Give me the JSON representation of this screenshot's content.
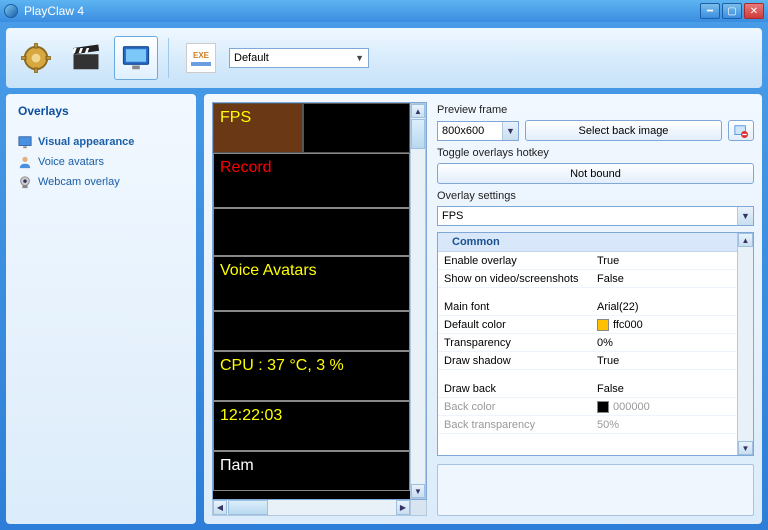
{
  "window": {
    "title": "PlayClaw 4"
  },
  "toolbar": {
    "profile_label": "Default",
    "icons": {
      "settings": "gear-icon",
      "recording": "clapper-icon",
      "overlays": "monitor-icon",
      "exe": "exe-icon"
    }
  },
  "sidebar": {
    "header": "Overlays",
    "items": [
      {
        "label": "Visual appearance",
        "selected": true
      },
      {
        "label": "Voice avatars",
        "selected": false
      },
      {
        "label": "Webcam overlay",
        "selected": false
      }
    ]
  },
  "preview": {
    "overlays": {
      "fps": "FPS",
      "record": "Record",
      "voice": "Voice Avatars",
      "cpu": "CPU : 37 °C, 3 %",
      "time": "12:22:03",
      "cam": "Пam"
    }
  },
  "right": {
    "preview_frame_label": "Preview frame",
    "preview_size": "800x600",
    "select_back_image": "Select back image",
    "toggle_label": "Toggle overlays hotkey",
    "hotkey_value": "Not bound",
    "overlay_settings_label": "Overlay settings",
    "overlay_selected": "FPS"
  },
  "settings": {
    "group1": "Common",
    "rows": [
      {
        "k": "Enable overlay",
        "v": "True"
      },
      {
        "k": "Show on video/screenshots",
        "v": "False"
      }
    ],
    "rows2": [
      {
        "k": "Main font",
        "v": "Arial(22)"
      },
      {
        "k": "Default color",
        "v": "ffc000",
        "color": "#ffc000"
      },
      {
        "k": "Transparency",
        "v": "0%"
      },
      {
        "k": "Draw shadow",
        "v": "True"
      }
    ],
    "rows3": [
      {
        "k": "Draw back",
        "v": "False"
      },
      {
        "k": "Back color",
        "v": "000000",
        "color": "#000000",
        "disabled": true
      },
      {
        "k": "Back transparency",
        "v": "50%",
        "disabled": true
      }
    ]
  }
}
